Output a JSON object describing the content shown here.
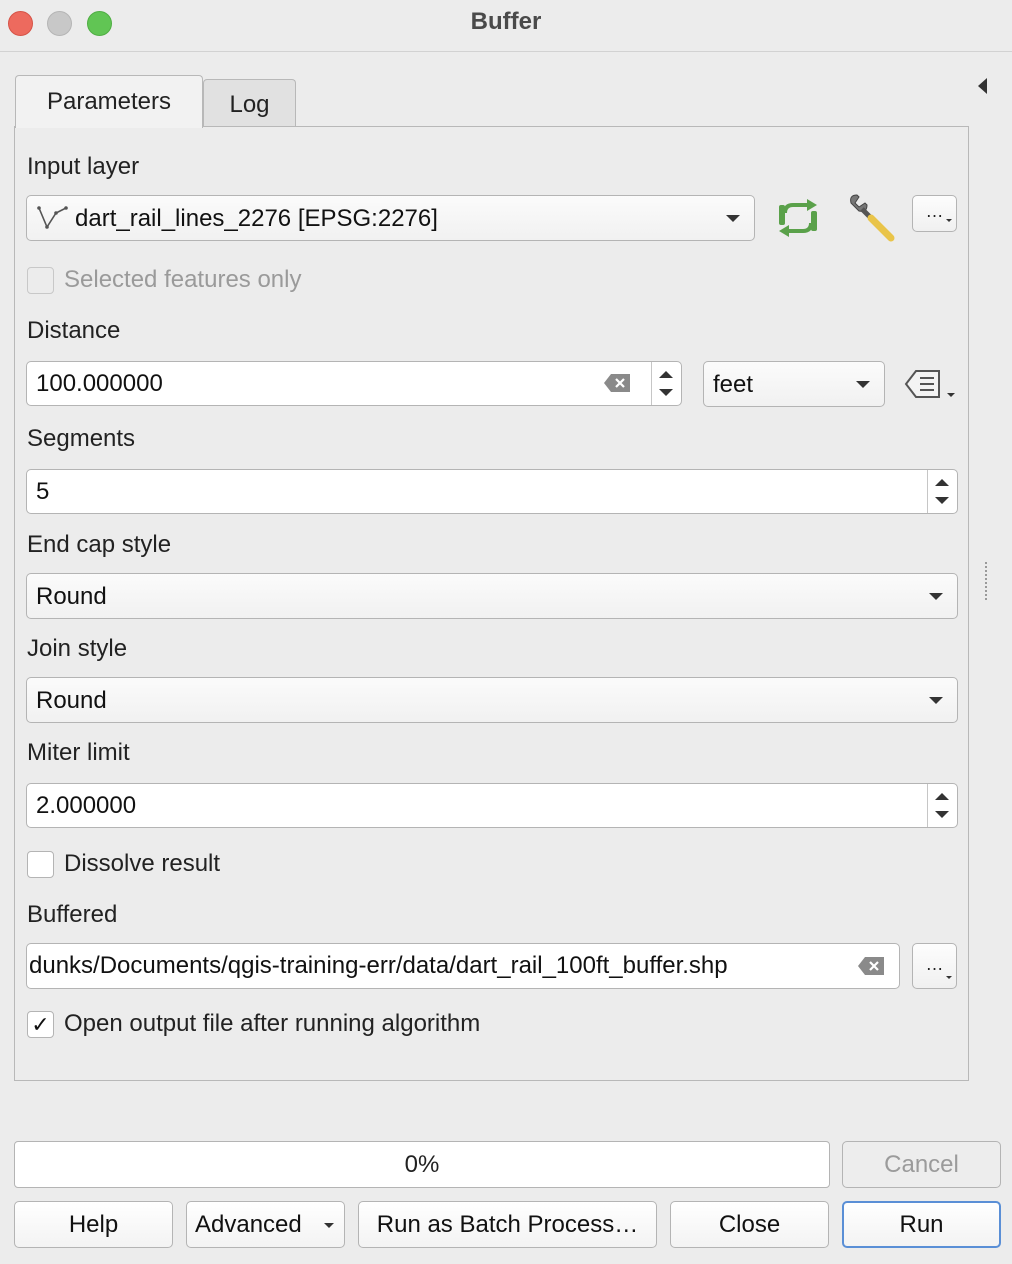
{
  "window": {
    "title": "Buffer"
  },
  "tabs": [
    {
      "label": "Parameters",
      "active": true
    },
    {
      "label": "Log",
      "active": false
    }
  ],
  "input_layer": {
    "label": "Input layer",
    "value": "dart_rail_lines_2276 [EPSG:2276]",
    "more_button": "…"
  },
  "selected_only": {
    "label": "Selected features only",
    "checked": false,
    "enabled": false
  },
  "distance": {
    "label": "Distance",
    "value": "100.000000",
    "unit": "feet"
  },
  "segments": {
    "label": "Segments",
    "value": "5"
  },
  "end_cap_style": {
    "label": "End cap style",
    "value": "Round"
  },
  "join_style": {
    "label": "Join style",
    "value": "Round"
  },
  "miter_limit": {
    "label": "Miter limit",
    "value": "2.000000"
  },
  "dissolve": {
    "label": "Dissolve result",
    "checked": false
  },
  "buffered": {
    "label": "Buffered",
    "value": "dunks/Documents/qgis-training-err/data/dart_rail_100ft_buffer.shp",
    "more_button": "…"
  },
  "open_output": {
    "label": "Open output file after running algorithm",
    "checked": true,
    "check_glyph": "✓"
  },
  "progress": {
    "text": "0%",
    "fraction": 0
  },
  "buttons": {
    "cancel": "Cancel",
    "help": "Help",
    "advanced": "Advanced",
    "batch": "Run as Batch Process…",
    "close": "Close",
    "run": "Run"
  }
}
